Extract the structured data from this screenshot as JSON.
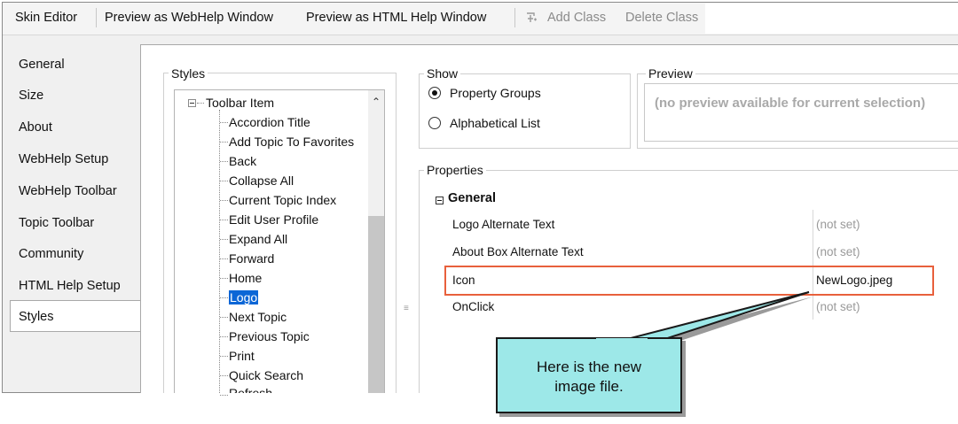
{
  "toolbar": {
    "skin_editor": "Skin Editor",
    "preview_webhelp": "Preview as WebHelp Window",
    "preview_htmlhelp": "Preview as HTML Help Window",
    "add_class": "Add Class",
    "delete_class": "Delete Class",
    "add_class_icon": "add-class-icon"
  },
  "sidebar": {
    "items": [
      {
        "label": "General"
      },
      {
        "label": "Size"
      },
      {
        "label": "About"
      },
      {
        "label": "WebHelp Setup"
      },
      {
        "label": "WebHelp Toolbar"
      },
      {
        "label": "Topic Toolbar"
      },
      {
        "label": "Community"
      },
      {
        "label": "HTML Help Setup"
      },
      {
        "label": "Styles"
      }
    ],
    "selected": "Styles"
  },
  "styles": {
    "title": "Styles",
    "root": "Toolbar Item",
    "items": [
      "Accordion Title",
      "Add Topic To Favorites",
      "Back",
      "Collapse All",
      "Current Topic Index",
      "Edit User Profile",
      "Expand All",
      "Forward",
      "Home",
      "Logo",
      "Next Topic",
      "Previous Topic",
      "Print",
      "Quick Search",
      "Refresh"
    ],
    "selected": "Logo"
  },
  "show": {
    "title": "Show",
    "options": [
      "Property Groups",
      "Alphabetical List"
    ],
    "selected": "Property Groups"
  },
  "preview": {
    "title": "Preview",
    "message": "(no preview available for current selection)"
  },
  "properties": {
    "title": "Properties",
    "group": "General",
    "rows": [
      {
        "name": "Logo Alternate Text",
        "value": "(not set)"
      },
      {
        "name": "About Box Alternate Text",
        "value": "(not set)"
      },
      {
        "name": "Icon",
        "value": "NewLogo.jpeg"
      },
      {
        "name": "OnClick",
        "value": "(not set)"
      }
    ]
  },
  "callout": {
    "line1": "Here is the new",
    "line2": "image file.",
    "fill": "#9de8e8"
  },
  "colors": {
    "highlight_border": "#e8603c",
    "selection": "#0b66d6"
  }
}
